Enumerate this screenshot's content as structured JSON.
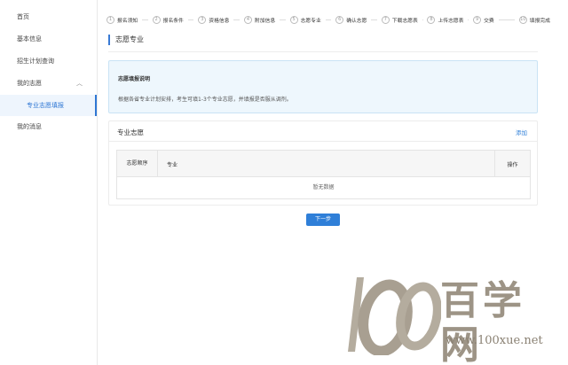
{
  "sidebar": {
    "items": [
      {
        "label": "首页"
      },
      {
        "label": "基本信息"
      },
      {
        "label": "招生计划查询"
      },
      {
        "label": "我的志愿",
        "expanded": true
      },
      {
        "label": "专业志愿填报",
        "active": true
      },
      {
        "label": "我的消息"
      }
    ]
  },
  "steps": [
    {
      "num": "1",
      "label": "报名须知"
    },
    {
      "num": "2",
      "label": "报名条件"
    },
    {
      "num": "3",
      "label": "资格信息"
    },
    {
      "num": "4",
      "label": "附加信息"
    },
    {
      "num": "5",
      "label": "志愿专业"
    },
    {
      "num": "6",
      "label": "确认志愿"
    },
    {
      "num": "7",
      "label": "下载志愿表"
    },
    {
      "num": "8",
      "label": "上传志愿表"
    },
    {
      "num": "9",
      "label": "交费"
    },
    {
      "num": "10",
      "label": "填报完成"
    }
  ],
  "page": {
    "title": "志愿专业"
  },
  "notice": {
    "title": "志愿填报说明",
    "text": "根据各省专业计划安排，考生可填1-3个专业志愿，并填报是否服从调剂。"
  },
  "panel": {
    "title": "专业志愿",
    "add_label": "添加",
    "table": {
      "headers": [
        "志愿顺序",
        "专业",
        "操作"
      ],
      "empty_text": "暂无数据"
    }
  },
  "actions": {
    "next_label": "下一步"
  },
  "watermark": {
    "chinese": "百学网",
    "url": "www.100xue.net"
  },
  "colors": {
    "accent": "#2f7fd8",
    "notice_bg": "#eef7fd",
    "watermark": "#9d9486"
  }
}
